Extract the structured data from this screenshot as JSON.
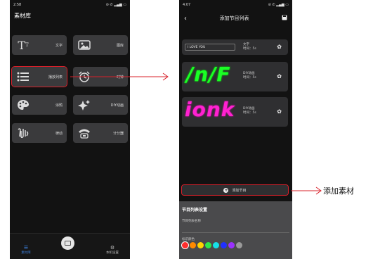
{
  "phone1": {
    "status_time": "2:58",
    "status_icons": "⊘ ✆ ▂▄▆ ▭",
    "title": "素材库",
    "tiles": [
      {
        "icon": "text-icon",
        "glyph": "T",
        "label": "文字"
      },
      {
        "icon": "image-icon",
        "glyph": "▣",
        "label": "图库"
      },
      {
        "icon": "list-icon",
        "glyph": "☰",
        "label": "播放列表"
      },
      {
        "icon": "clock-icon",
        "glyph": "◔",
        "label": "时钟"
      },
      {
        "icon": "palette-icon",
        "glyph": "✿",
        "label": "涂鸦"
      },
      {
        "icon": "sparkle-icon",
        "glyph": "✦",
        "label": "DIY动画"
      },
      {
        "icon": "rhythm-icon",
        "glyph": "♫",
        "label": "律动"
      },
      {
        "icon": "scoreboard-icon",
        "glyph": "☎",
        "label": "计分器"
      }
    ],
    "nav": {
      "left_label": "素材库",
      "right_label": "本机设置"
    }
  },
  "phone2": {
    "status_time": "4:07",
    "status_icons": "⊘ ✆ ▂▄▆ ▭",
    "title": "添加节目列表",
    "programs": [
      {
        "text": "I LOVE YOU",
        "type": "文字",
        "duration": "时间：5s"
      },
      {
        "led": "/n/F",
        "type": "DIY动画",
        "duration": "时间：5s"
      },
      {
        "led": "ionk",
        "type": "DIY动画",
        "duration": "时间：5s"
      }
    ],
    "add_button": "添加节目",
    "sheet": {
      "heading": "节目列表设置",
      "name_field": "节目列表名称",
      "color_label": "标识颜色",
      "colors": [
        "#ff2d2d",
        "#ff8a00",
        "#ffd400",
        "#2ee84a",
        "#16e0e8",
        "#2030ff",
        "#9b30ff",
        "#9a9a9a"
      ]
    }
  },
  "annotation": "添加素材"
}
